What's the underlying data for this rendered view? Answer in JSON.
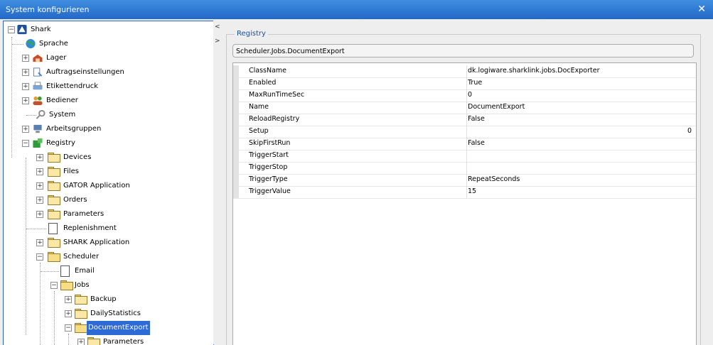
{
  "window": {
    "title": "System konfigurieren",
    "close_glyph": "✕"
  },
  "tree": {
    "items": [
      {
        "label": "Shark",
        "icon": "shark-icon"
      },
      {
        "label": "Sprache",
        "icon": "globe-icon"
      },
      {
        "label": "Lager",
        "icon": "warehouse-icon"
      },
      {
        "label": "Auftragseinstellungen",
        "icon": "order-settings-icon"
      },
      {
        "label": "Etikettendruck",
        "icon": "label-printer-icon"
      },
      {
        "label": "Bediener",
        "icon": "users-icon"
      },
      {
        "label": "System",
        "icon": "system-icon"
      },
      {
        "label": "Arbeitsgruppen",
        "icon": "workgroup-icon"
      },
      {
        "label": "Registry",
        "icon": "registry-icon"
      },
      {
        "label": "Devices",
        "icon": "folder-icon"
      },
      {
        "label": "Files",
        "icon": "folder-icon"
      },
      {
        "label": "GATOR Application",
        "icon": "folder-icon"
      },
      {
        "label": "Orders",
        "icon": "folder-icon"
      },
      {
        "label": "Parameters",
        "icon": "folder-icon"
      },
      {
        "label": "Replenishment",
        "icon": "document-icon"
      },
      {
        "label": "SHARK Application",
        "icon": "folder-icon"
      },
      {
        "label": "Scheduler",
        "icon": "folder-open-icon"
      },
      {
        "label": "Email",
        "icon": "document-icon"
      },
      {
        "label": "Jobs",
        "icon": "folder-open-icon"
      },
      {
        "label": "Backup",
        "icon": "folder-icon"
      },
      {
        "label": "DailyStatistics",
        "icon": "folder-icon"
      },
      {
        "label": "DocumentExport",
        "icon": "folder-open-icon"
      },
      {
        "label": "Parameters",
        "icon": "folder-icon"
      }
    ]
  },
  "splitter": {
    "left_arrow": "<",
    "right_arrow": ">"
  },
  "registry": {
    "legend": "Registry",
    "path": "Scheduler.Jobs.DocumentExport",
    "properties": [
      {
        "key": "ClassName",
        "value": "dk.logiware.sharklink.jobs.DocExporter"
      },
      {
        "key": "Enabled",
        "value": "True"
      },
      {
        "key": "MaxRunTimeSec",
        "value": "0"
      },
      {
        "key": "Name",
        "value": "DocumentExport"
      },
      {
        "key": "ReloadRegistry",
        "value": "False"
      },
      {
        "key": "Setup",
        "value": "0"
      },
      {
        "key": "SkipFirstRun",
        "value": "False"
      },
      {
        "key": "TriggerStart",
        "value": ""
      },
      {
        "key": "TriggerStop",
        "value": ""
      },
      {
        "key": "TriggerType",
        "value": "RepeatSeconds"
      },
      {
        "key": "TriggerValue",
        "value": "15"
      }
    ]
  },
  "colors": {
    "title_bar": "#2d6ad6",
    "selection": "#2d6ad6",
    "legend_text": "#1c4f99"
  }
}
